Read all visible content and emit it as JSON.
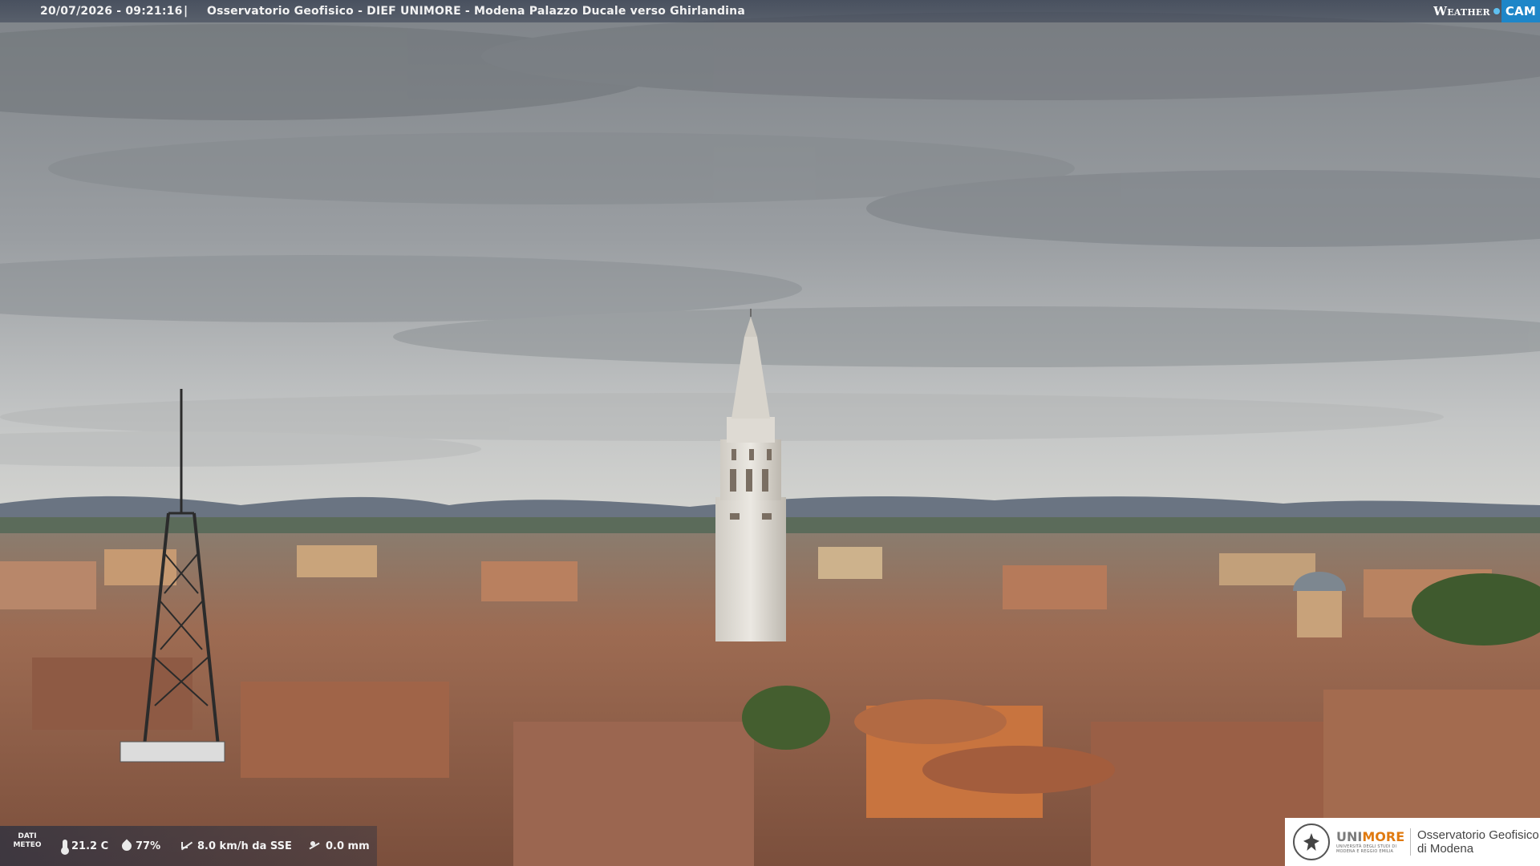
{
  "header": {
    "timestamp": "20/07/2026 - 09:21:16",
    "separator": "|",
    "caption": "Osservatorio Geofisico - DIEF UNIMORE - Modena Palazzo Ducale verso Ghirlandina"
  },
  "brand": {
    "weather": "Weather",
    "cam": "CAM",
    "accent": "#1e86c8"
  },
  "weather": {
    "label": "DATI METEO",
    "temperature": "21.2 C",
    "humidity": "77%",
    "wind": "8.0 km/h da SSE",
    "rain": "0.0 mm"
  },
  "university": {
    "name_part1": "UNI",
    "name_part2": "MORE",
    "subtitle": "UNIVERSITÀ DEGLI STUDI DI MODENA E REGGIO EMILIA",
    "observatory_line1": "Osservatorio Geofisico",
    "observatory_line2": "di Modena"
  },
  "colors": {
    "sky": "#a3a7ab",
    "roof": "#a8664a",
    "tower": "#e4e1db",
    "unimore_orange": "#e07a10"
  }
}
